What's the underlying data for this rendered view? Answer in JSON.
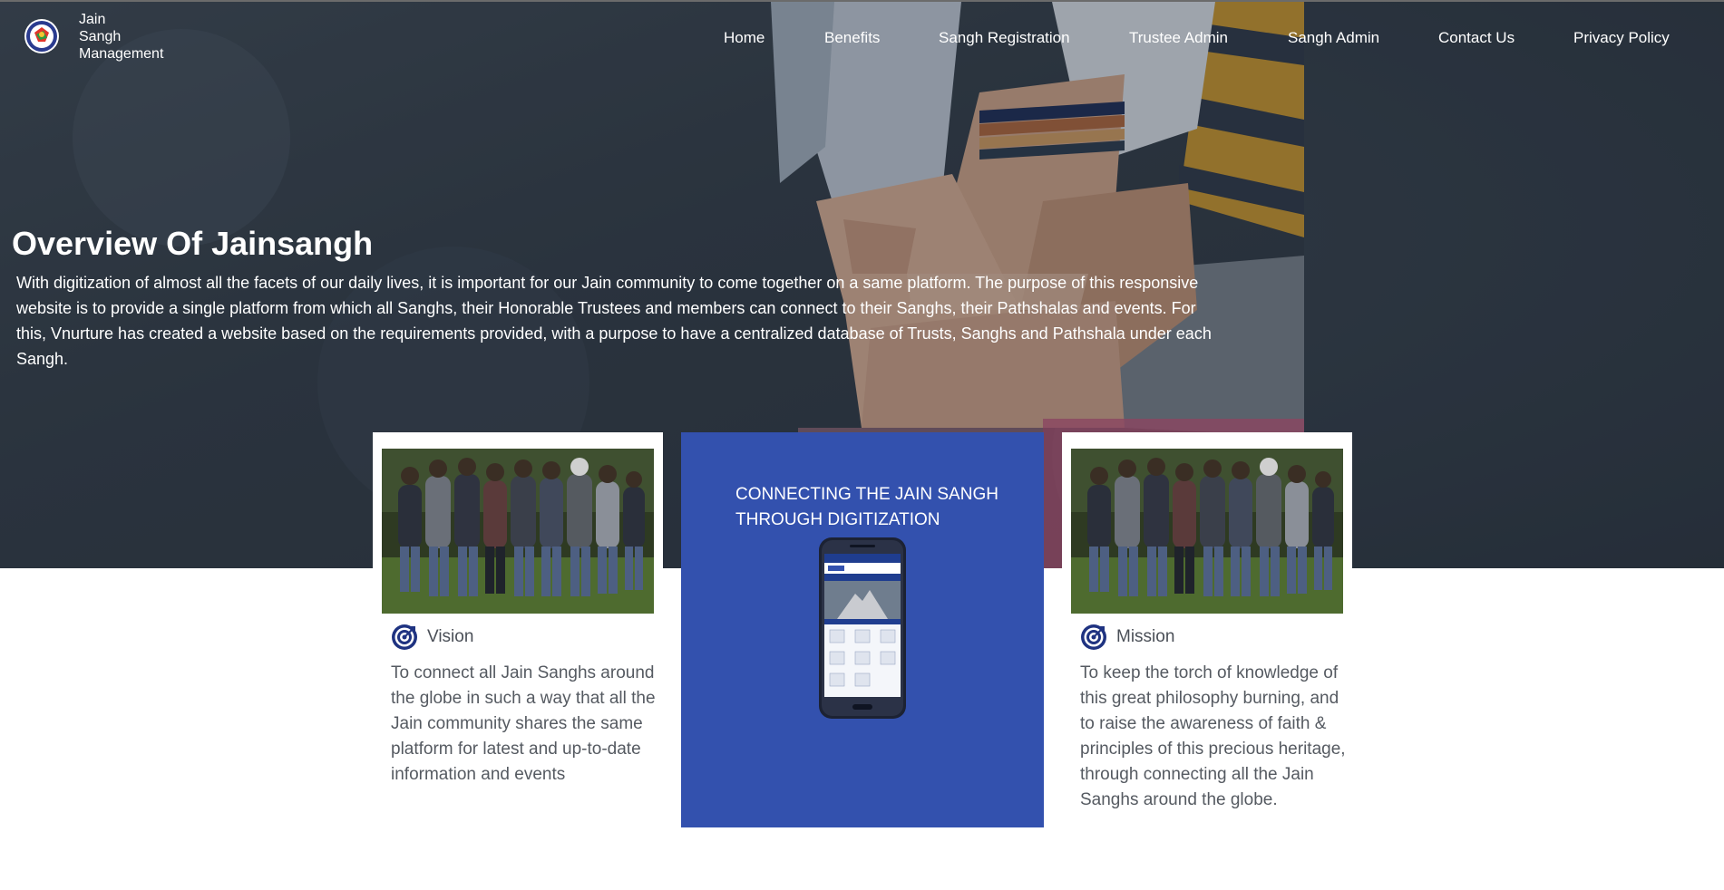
{
  "brand": {
    "line1": "Jain",
    "line2": "Sangh",
    "line3": "Management",
    "logo_icon": "jain-sangh-logo-icon"
  },
  "nav": {
    "items": [
      {
        "label": "Home"
      },
      {
        "label": "Benefits"
      },
      {
        "label": "Sangh Registration"
      },
      {
        "label": "Trustee Admin"
      },
      {
        "label": "Sangh Admin"
      },
      {
        "label": "Contact Us"
      },
      {
        "label": "Privacy Policy"
      }
    ]
  },
  "overview": {
    "title": "Overview Of Jainsangh",
    "text": "With digitization of almost all the facets of our daily lives, it is important for our Jain community to come together on a same platform. The purpose of this responsive website is to provide a single platform from which all Sanghs, their Honorable Trustees and members can connect to their Sanghs, their Pathshalas and events. For this, Vnurture has created a website based on the requirements provided, with a purpose to have a centralized database of Trusts, Sanghs and Pathshala under each Sangh."
  },
  "vision": {
    "label": "Vision",
    "icon": "target-icon",
    "text": "To connect all Jain Sanghs around the globe in such a way that all the Jain community shares the same platform for latest and up-to-date information and events"
  },
  "center": {
    "title": "CONNECTING THE JAIN SANGH THROUGH DIGITIZATION"
  },
  "mission": {
    "label": "Mission",
    "icon": "target-icon",
    "text": "To keep the torch of knowledge of this great philosophy burning, and to raise the awareness of faith & principles of this precious heritage, through connecting all the Jain Sanghs around the globe."
  },
  "colors": {
    "accent_blue": "#3351ae",
    "icon_navy": "#1f3381",
    "hero_dark": "#2f3944"
  }
}
